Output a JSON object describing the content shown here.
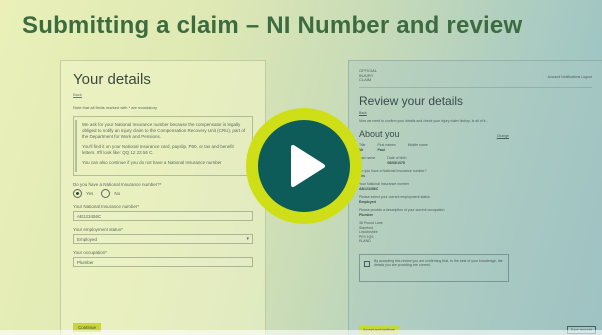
{
  "slide": {
    "title": "Submitting a claim – NI Number and review"
  },
  "left_screen": {
    "heading": "Your details",
    "back_link": "Back",
    "mandatory_note": "Note that all fields marked with * are mandatory",
    "info_box": {
      "paragraph_1": "We ask for your National Insurance number because the compensator is legally obliged to notify an injury claim to the Compensation Recovery Unit (CRU), part of the Department for Work and Pensions.",
      "paragraph_2": "You'll find it on your National Insurance card, payslip, P60, or tax and benefit letters. It'll look like: QQ 12 23 56 C.",
      "paragraph_3": "You can also continue if you do not have a National Insurance number"
    },
    "ni_question": "Do you have a National Insurance number?*",
    "radio_yes": "Yes",
    "radio_no": "No",
    "ni_label": "Your National Insurance number*",
    "ni_value": "AB123456C",
    "employment_label": "Your employment status*",
    "employment_value": "Employed",
    "occupation_label": "Your occupation*",
    "occupation_value": "Plumber",
    "continue_button": "Continue"
  },
  "right_screen": {
    "logo_line_1": "OFFICIAL",
    "logo_line_2": "INJURY",
    "logo_line_3": "CLAIM",
    "account_links": "Account  Notifications  Logout",
    "heading": "Review your details",
    "back_link": "Back",
    "intro_text": "Now we need to confirm your details and check your injury claim history. Is all of it...",
    "section_title": "About you",
    "change_link": "Change",
    "title_label": "Title",
    "title_value": "Mr",
    "first_name_label": "First names",
    "first_name_value": "Paul",
    "middle_name_label": "Middle name",
    "last_name_label": "Last name",
    "dob_label": "Date of birth",
    "dob_value": "08/08/1978",
    "ni_question": "Do you have a National Insurance number?",
    "ni_answer": "Yes",
    "ni_label": "Your National Insurance number",
    "ni_value": "AB123456C",
    "employment_label": "Please select your current employment status",
    "employment_value": "Employed",
    "occupation_label": "Please provide a description of your current occupation",
    "occupation_value": "Plumber",
    "address_line_1": "38 Pound Lane",
    "address_line_2": "Stamford",
    "address_line_3": "Lincolnshire",
    "address_line_4": "PE9 1QS",
    "address_line_5": "ELAND",
    "notice_text": "By accepting this review you are confirming that, to the best of your knowledge, the details you are providing are correct.",
    "accept_button": "Accept and continue",
    "save_button": "Save and exit"
  },
  "player": {
    "play_icon": "play-icon",
    "ring_color": "#cfdf17",
    "center_color": "#0d5c5a"
  }
}
